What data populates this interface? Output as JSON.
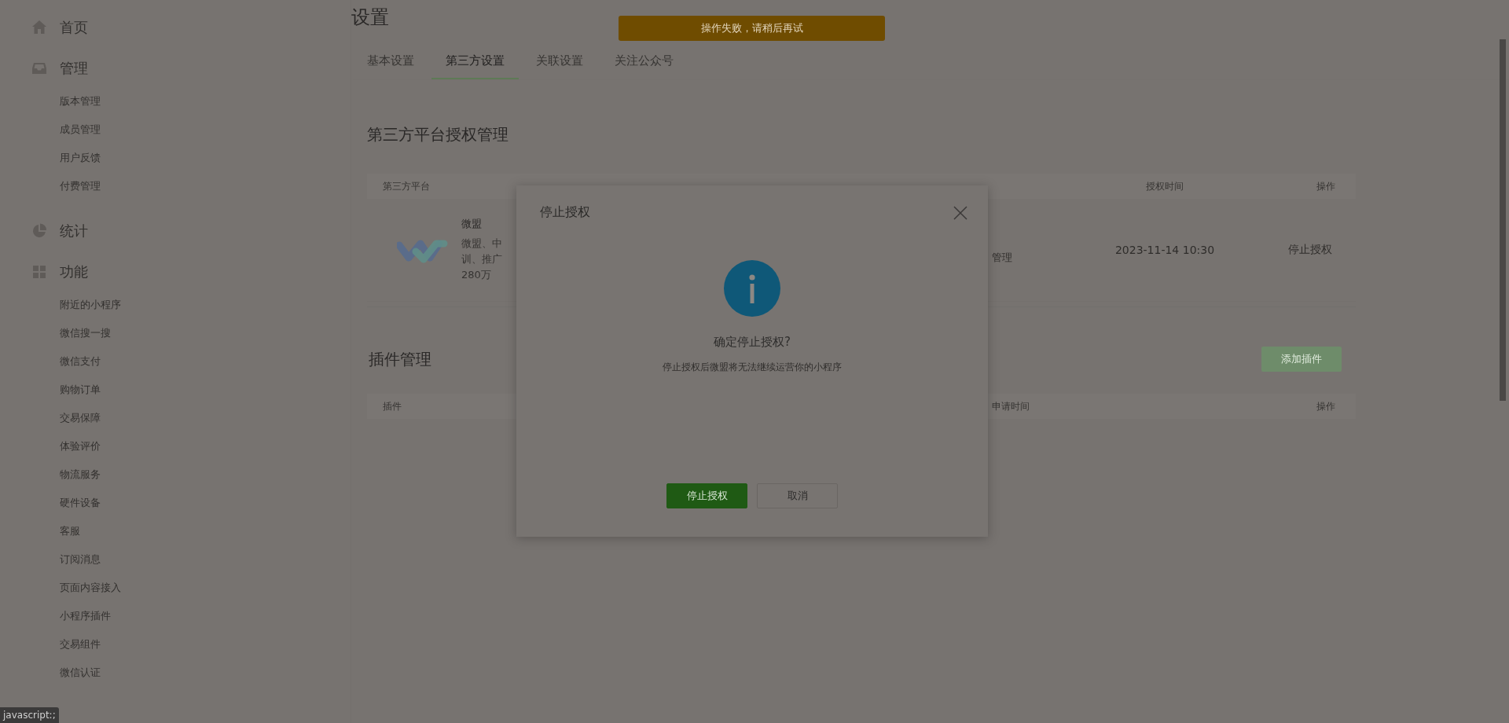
{
  "sidebar": {
    "sections": [
      {
        "label": "首页"
      },
      {
        "label": "管理",
        "items": [
          "版本管理",
          "成员管理",
          "用户反馈",
          "付费管理"
        ]
      },
      {
        "label": "统计"
      },
      {
        "label": "功能",
        "items": [
          "附近的小程序",
          "微信搜一搜",
          "微信支付",
          "购物订单",
          "交易保障",
          "体验评价",
          "物流服务",
          "硬件设备",
          "客服",
          "订阅消息",
          "页面内容接入",
          "小程序插件",
          "交易组件",
          "微信认证"
        ]
      }
    ]
  },
  "page_title": "设置",
  "toast": {
    "text": "操作失败，请稍后再试"
  },
  "tabs": [
    {
      "label": "基本设置",
      "selected": false
    },
    {
      "label": "第三方设置",
      "selected": true
    },
    {
      "label": "关联设置",
      "selected": false
    },
    {
      "label": "关注公众号",
      "selected": false
    }
  ],
  "auth_section": {
    "title": "第三方平台授权管理",
    "columns": [
      "第三方平台",
      "授权时间",
      "操作"
    ],
    "rows": [
      {
        "name": "微盟",
        "description_lines": [
          "微盟、中",
          "训、推广",
          "280万"
        ],
        "column_3": "管理",
        "time": "2023-11-14 10:30",
        "action": "停止授权"
      }
    ]
  },
  "plugin_section": {
    "title": "插件管理",
    "add_button": "添加插件",
    "columns": [
      "插件",
      "申请时间",
      "操作"
    ]
  },
  "dialog": {
    "title": "停止授权",
    "heading": "确定停止授权?",
    "message": "停止授权后微盟将无法继续运营你的小程序",
    "buttons": [
      {
        "label": "停止授权",
        "kind": "primary"
      },
      {
        "label": "取消",
        "kind": "secondary"
      }
    ]
  },
  "status_bar": {
    "text": "javascript:;"
  }
}
